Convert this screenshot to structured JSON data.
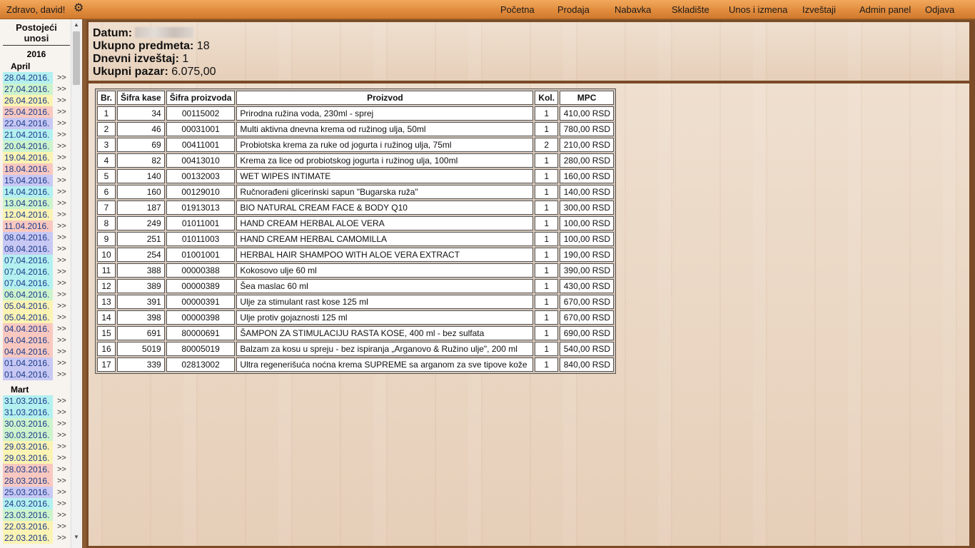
{
  "header": {
    "greeting": "Zdravo, david!",
    "settings_icon": "gear-icon",
    "nav": [
      {
        "label": "Početna"
      },
      {
        "label": "Prodaja"
      },
      {
        "label": "Nabavka"
      },
      {
        "label": "Skladište"
      },
      {
        "label": "Unos i izmena"
      },
      {
        "label": "Izveštaji"
      },
      {
        "label": "Admin panel"
      },
      {
        "label": "Odjava"
      }
    ]
  },
  "sidebar": {
    "title": "Postojeći unosi",
    "year": "2016",
    "go_label": ">>",
    "months": [
      {
        "name": "April",
        "entries": [
          {
            "date": "28.04.2016.",
            "color": "#b3f0f0"
          },
          {
            "date": "27.04.2016.",
            "color": "#cdf3cd"
          },
          {
            "date": "26.04.2016.",
            "color": "#fbf3b3"
          },
          {
            "date": "25.04.2016.",
            "color": "#f8c8c0"
          },
          {
            "date": "22.04.2016.",
            "color": "#c8c8f4"
          },
          {
            "date": "21.04.2016.",
            "color": "#b3f0f0"
          },
          {
            "date": "20.04.2016.",
            "color": "#cdf3cd"
          },
          {
            "date": "19.04.2016.",
            "color": "#fbf3b3"
          },
          {
            "date": "18.04.2016.",
            "color": "#f8c8c0"
          },
          {
            "date": "15.04.2016.",
            "color": "#c8c8f4"
          },
          {
            "date": "14.04.2016.",
            "color": "#b3f0f0"
          },
          {
            "date": "13.04.2016.",
            "color": "#cdf3cd"
          },
          {
            "date": "12.04.2016.",
            "color": "#fbf3b3"
          },
          {
            "date": "11.04.2016.",
            "color": "#f8c8c0"
          },
          {
            "date": "08.04.2016.",
            "color": "#c8c8f4"
          },
          {
            "date": "08.04.2016.",
            "color": "#c8c8f4"
          },
          {
            "date": "07.04.2016.",
            "color": "#b3f0f0"
          },
          {
            "date": "07.04.2016.",
            "color": "#b3f0f0"
          },
          {
            "date": "07.04.2016.",
            "color": "#b3f0f0"
          },
          {
            "date": "06.04.2016.",
            "color": "#cdf3cd"
          },
          {
            "date": "05.04.2016.",
            "color": "#fbf3b3"
          },
          {
            "date": "05.04.2016.",
            "color": "#fbf3b3"
          },
          {
            "date": "04.04.2016.",
            "color": "#f8c8c0"
          },
          {
            "date": "04.04.2016.",
            "color": "#f8c8c0"
          },
          {
            "date": "04.04.2016.",
            "color": "#f8c8c0"
          },
          {
            "date": "01.04.2016.",
            "color": "#c8c8f4"
          },
          {
            "date": "01.04.2016.",
            "color": "#c8c8f4"
          }
        ]
      },
      {
        "name": "Mart",
        "entries": [
          {
            "date": "31.03.2016.",
            "color": "#b3f0f0"
          },
          {
            "date": "31.03.2016.",
            "color": "#b3f0f0"
          },
          {
            "date": "30.03.2016.",
            "color": "#cdf3cd"
          },
          {
            "date": "30.03.2016.",
            "color": "#cdf3cd"
          },
          {
            "date": "29.03.2016.",
            "color": "#fbf3b3"
          },
          {
            "date": "29.03.2016.",
            "color": "#fbf3b3"
          },
          {
            "date": "28.03.2016.",
            "color": "#f8c8c0"
          },
          {
            "date": "28.03.2016.",
            "color": "#f8c8c0"
          },
          {
            "date": "25.03.2016.",
            "color": "#c8c8f4"
          },
          {
            "date": "24.03.2016.",
            "color": "#b3f0f0"
          },
          {
            "date": "23.03.2016.",
            "color": "#cdf3cd"
          },
          {
            "date": "22.03.2016.",
            "color": "#fbf3b3"
          },
          {
            "date": "22.03.2016.",
            "color": "#fbf3b3"
          }
        ]
      }
    ]
  },
  "summary": {
    "date_label": "Datum:",
    "total_items_label": "Ukupno predmeta:",
    "total_items_value": "18",
    "daily_report_label": "Dnevni izveštaj:",
    "daily_report_value": "1",
    "total_sales_label": "Ukupni pazar:",
    "total_sales_value": "6.075,00"
  },
  "table": {
    "columns": [
      "Br.",
      "Šifra kase",
      "Šifra proizvoda",
      "Proizvod",
      "Kol.",
      "MPC"
    ],
    "rows": [
      [
        "1",
        "34",
        "00115002",
        "Prirodna ružina voda, 230ml - sprej",
        "1",
        "410,00 RSD"
      ],
      [
        "2",
        "46",
        "00031001",
        "Multi aktivna dnevna krema od ružinog ulja, 50ml",
        "1",
        "780,00 RSD"
      ],
      [
        "3",
        "69",
        "00411001",
        "Probiotska krema za ruke od jogurta i ružinog ulja, 75ml",
        "2",
        "210,00 RSD"
      ],
      [
        "4",
        "82",
        "00413010",
        "Krema za lice od probiotskog jogurta i ružinog ulja, 100ml",
        "1",
        "280,00 RSD"
      ],
      [
        "5",
        "140",
        "00132003",
        "WET WIPES INTIMATE",
        "1",
        "160,00 RSD"
      ],
      [
        "6",
        "160",
        "00129010",
        "Ručnorađeni glicerinski sapun \"Bugarska ruža\"",
        "1",
        "140,00 RSD"
      ],
      [
        "7",
        "187",
        "01913013",
        "BIO NATURAL CREAM FACE & BODY Q10",
        "1",
        "300,00 RSD"
      ],
      [
        "8",
        "249",
        "01011001",
        "HAND CREAM HERBAL ALOE VERA",
        "1",
        "100,00 RSD"
      ],
      [
        "9",
        "251",
        "01011003",
        "HAND CREAM HERBAL CAMOMILLA",
        "1",
        "100,00 RSD"
      ],
      [
        "10",
        "254",
        "01001001",
        "HERBAL HAIR SHAMPOO WITH ALOE VERA EXTRACT",
        "1",
        "190,00 RSD"
      ],
      [
        "11",
        "388",
        "00000388",
        "Kokosovo ulje 60 ml",
        "1",
        "390,00 RSD"
      ],
      [
        "12",
        "389",
        "00000389",
        "Šea maslac 60 ml",
        "1",
        "430,00 RSD"
      ],
      [
        "13",
        "391",
        "00000391",
        "Ulje za stimulant rast kose 125 ml",
        "1",
        "670,00 RSD"
      ],
      [
        "14",
        "398",
        "00000398",
        "Ulje protiv gojaznosti 125 ml",
        "1",
        "670,00 RSD"
      ],
      [
        "15",
        "691",
        "80000691",
        "ŠAMPON ZA STIMULACIJU RASTA KOSE, 400 ml - bez sulfata",
        "1",
        "690,00 RSD"
      ],
      [
        "16",
        "5019",
        "80005019",
        "Balzam za kosu u spreju - bez ispiranja „Arganovo & Ružino ulje\", 200 ml",
        "1",
        "540,00 RSD"
      ],
      [
        "17",
        "339",
        "02813002",
        "Ultra regenerišuća noćna krema SUPREME sa arganom za sve tipove kože",
        "1",
        "840,00 RSD"
      ]
    ]
  }
}
